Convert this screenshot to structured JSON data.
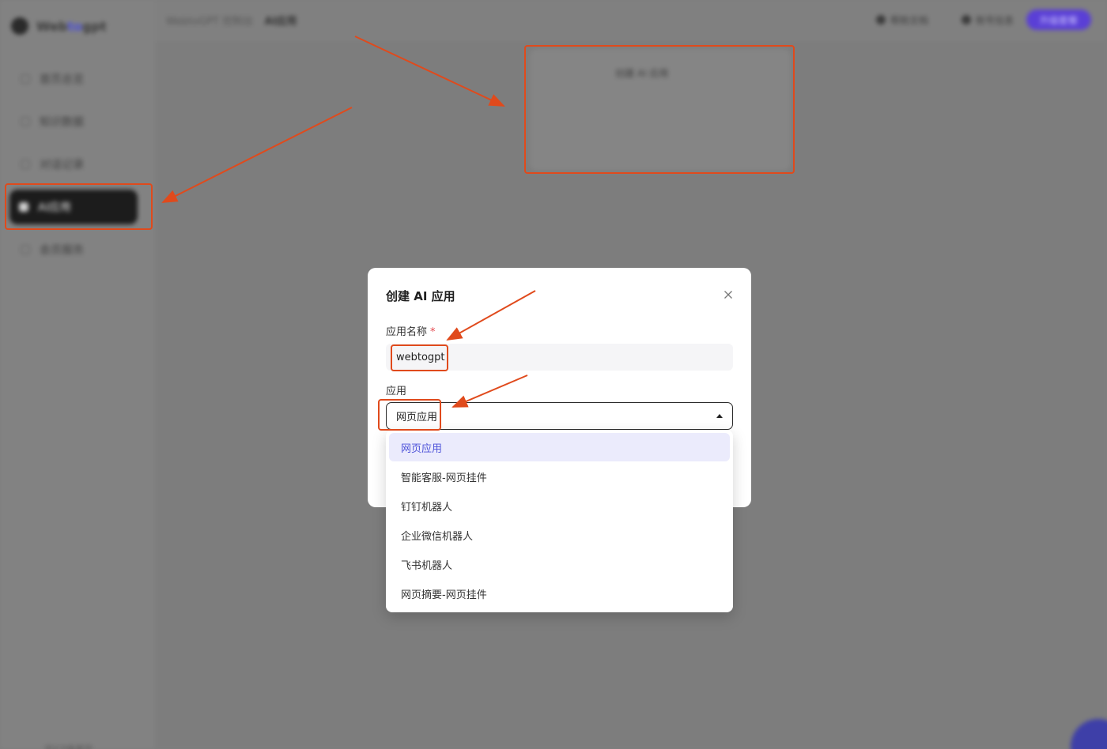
{
  "app": {
    "logo_prefix": "Web",
    "logo_highlight": "to",
    "logo_suffix": "gpt",
    "sidebar": {
      "items": [
        {
          "label": "首页总览",
          "icon": "home-icon"
        },
        {
          "label": "知识数据",
          "icon": "database-icon"
        },
        {
          "label": "对话记录",
          "icon": "chat-icon"
        },
        {
          "label": "AI应用",
          "icon": "app-icon"
        },
        {
          "label": "会员服务",
          "icon": "member-icon"
        }
      ]
    },
    "breadcrumb": {
      "parent": "WebtoGPT 控制台",
      "current": "AI应用"
    },
    "topbar": {
      "help": "帮助文档",
      "account": "账号信息",
      "upgrade": "升级套餐"
    },
    "create_card_label": "创建 AI 应用",
    "bottom_link": "京ICP备案号"
  },
  "modal": {
    "title": "创建 AI 应用",
    "close_icon": "close-icon",
    "name_label": "应用名称",
    "name_required_mark": "*",
    "name_value": "webtogpt",
    "app_label": "应用",
    "app_selected": "网页应用"
  },
  "dropdown": {
    "options": [
      "网页应用",
      "智能客服-网页挂件",
      "钉钉机器人",
      "企业微信机器人",
      "飞书机器人",
      "网页摘要-网页挂件"
    ],
    "selected_index": 0
  },
  "colors": {
    "accent": "#4d52d9",
    "annotation": "#e04a1c",
    "overlay": "#7e7e7e"
  }
}
